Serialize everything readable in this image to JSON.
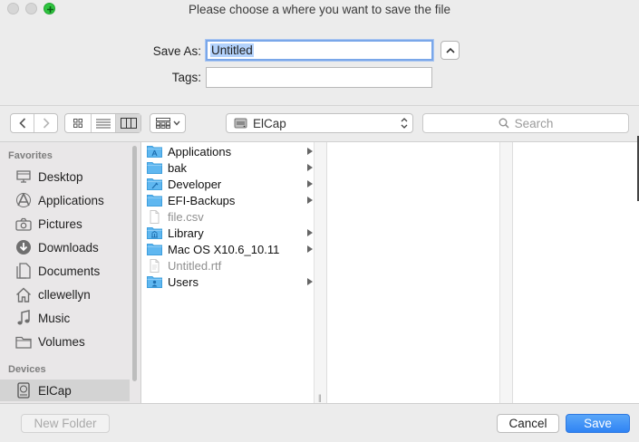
{
  "window": {
    "title": "Please choose a where you want to save the file"
  },
  "save_as": {
    "label": "Save As:",
    "value": "Untitled"
  },
  "tags": {
    "label": "Tags:",
    "value": ""
  },
  "location": {
    "label": "ElCap"
  },
  "search": {
    "placeholder": "Search"
  },
  "sidebar": {
    "favorites_heading": "Favorites",
    "favorites": [
      {
        "label": "Desktop",
        "icon": "desktop-icon"
      },
      {
        "label": "Applications",
        "icon": "applications-icon"
      },
      {
        "label": "Pictures",
        "icon": "camera-icon"
      },
      {
        "label": "Downloads",
        "icon": "download-icon"
      },
      {
        "label": "Documents",
        "icon": "documents-icon"
      },
      {
        "label": "cllewellyn",
        "icon": "home-icon"
      },
      {
        "label": "Music",
        "icon": "music-note-icon"
      },
      {
        "label": "Volumes",
        "icon": "folder-icon"
      }
    ],
    "devices_heading": "Devices",
    "devices": [
      {
        "label": "ElCap",
        "icon": "hard-drive-icon",
        "selected": true
      }
    ]
  },
  "browser": {
    "column1": [
      {
        "name": "Applications",
        "kind": "folder",
        "has_children": true,
        "enabled": true
      },
      {
        "name": "bak",
        "kind": "folder",
        "has_children": true,
        "enabled": true
      },
      {
        "name": "Developer",
        "kind": "folder",
        "has_children": true,
        "enabled": true
      },
      {
        "name": "EFI-Backups",
        "kind": "folder",
        "has_children": true,
        "enabled": true
      },
      {
        "name": "file.csv",
        "kind": "file",
        "has_children": false,
        "enabled": false
      },
      {
        "name": "Library",
        "kind": "folder",
        "has_children": true,
        "enabled": true
      },
      {
        "name": "Mac OS X10.6_10.11",
        "kind": "folder",
        "has_children": true,
        "enabled": true
      },
      {
        "name": "Untitled.rtf",
        "kind": "file",
        "has_children": false,
        "enabled": false
      },
      {
        "name": "Users",
        "kind": "folder",
        "has_children": true,
        "enabled": true
      }
    ]
  },
  "buttons": {
    "new_folder": "New Folder",
    "cancel": "Cancel",
    "save": "Save"
  },
  "colors": {
    "accent": "#2f83f4",
    "folder": "#5fb7f0",
    "selection": "#b3d2fc"
  }
}
